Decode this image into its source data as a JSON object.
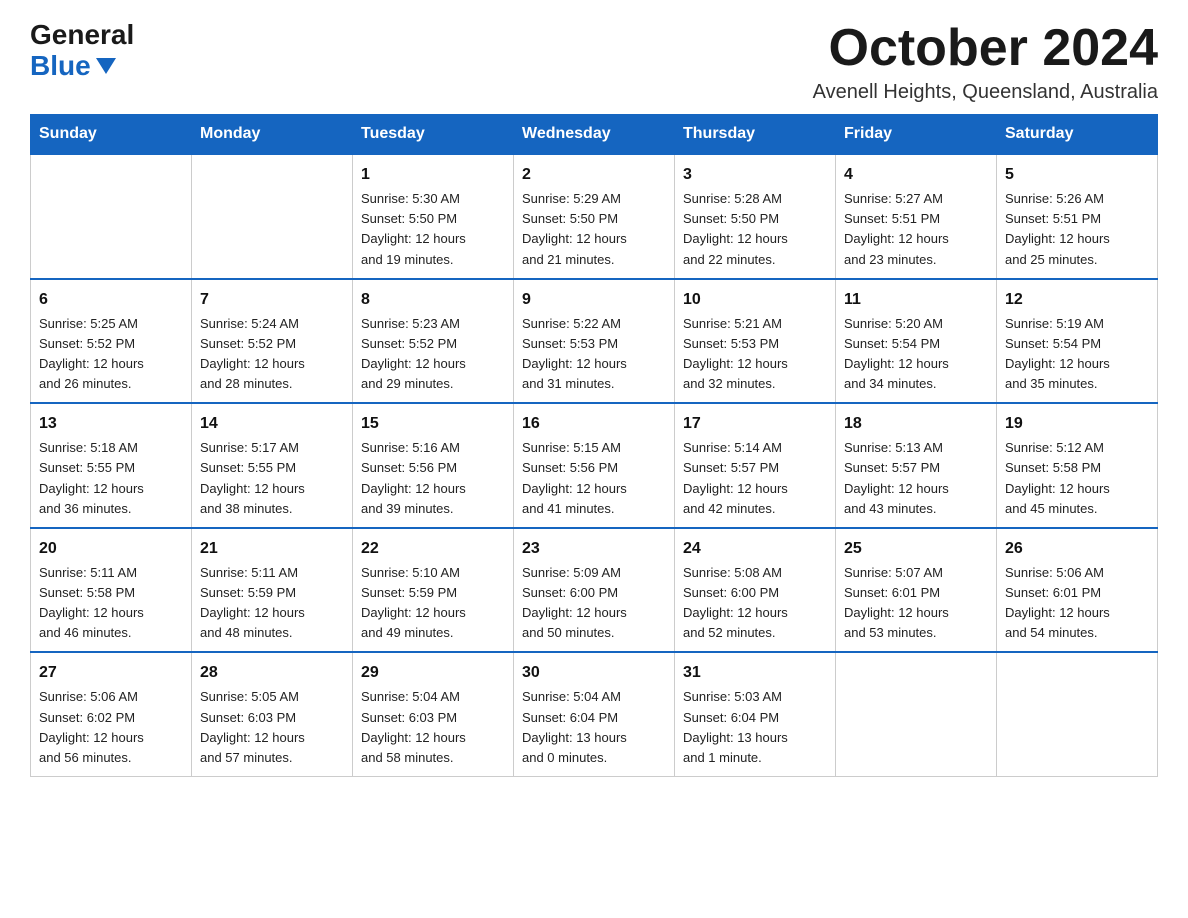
{
  "header": {
    "logo_general": "General",
    "logo_blue": "Blue",
    "month_title": "October 2024",
    "location": "Avenell Heights, Queensland, Australia"
  },
  "weekdays": [
    "Sunday",
    "Monday",
    "Tuesday",
    "Wednesday",
    "Thursday",
    "Friday",
    "Saturday"
  ],
  "weeks": [
    [
      {
        "day": "",
        "info": ""
      },
      {
        "day": "",
        "info": ""
      },
      {
        "day": "1",
        "info": "Sunrise: 5:30 AM\nSunset: 5:50 PM\nDaylight: 12 hours\nand 19 minutes."
      },
      {
        "day": "2",
        "info": "Sunrise: 5:29 AM\nSunset: 5:50 PM\nDaylight: 12 hours\nand 21 minutes."
      },
      {
        "day": "3",
        "info": "Sunrise: 5:28 AM\nSunset: 5:50 PM\nDaylight: 12 hours\nand 22 minutes."
      },
      {
        "day": "4",
        "info": "Sunrise: 5:27 AM\nSunset: 5:51 PM\nDaylight: 12 hours\nand 23 minutes."
      },
      {
        "day": "5",
        "info": "Sunrise: 5:26 AM\nSunset: 5:51 PM\nDaylight: 12 hours\nand 25 minutes."
      }
    ],
    [
      {
        "day": "6",
        "info": "Sunrise: 5:25 AM\nSunset: 5:52 PM\nDaylight: 12 hours\nand 26 minutes."
      },
      {
        "day": "7",
        "info": "Sunrise: 5:24 AM\nSunset: 5:52 PM\nDaylight: 12 hours\nand 28 minutes."
      },
      {
        "day": "8",
        "info": "Sunrise: 5:23 AM\nSunset: 5:52 PM\nDaylight: 12 hours\nand 29 minutes."
      },
      {
        "day": "9",
        "info": "Sunrise: 5:22 AM\nSunset: 5:53 PM\nDaylight: 12 hours\nand 31 minutes."
      },
      {
        "day": "10",
        "info": "Sunrise: 5:21 AM\nSunset: 5:53 PM\nDaylight: 12 hours\nand 32 minutes."
      },
      {
        "day": "11",
        "info": "Sunrise: 5:20 AM\nSunset: 5:54 PM\nDaylight: 12 hours\nand 34 minutes."
      },
      {
        "day": "12",
        "info": "Sunrise: 5:19 AM\nSunset: 5:54 PM\nDaylight: 12 hours\nand 35 minutes."
      }
    ],
    [
      {
        "day": "13",
        "info": "Sunrise: 5:18 AM\nSunset: 5:55 PM\nDaylight: 12 hours\nand 36 minutes."
      },
      {
        "day": "14",
        "info": "Sunrise: 5:17 AM\nSunset: 5:55 PM\nDaylight: 12 hours\nand 38 minutes."
      },
      {
        "day": "15",
        "info": "Sunrise: 5:16 AM\nSunset: 5:56 PM\nDaylight: 12 hours\nand 39 minutes."
      },
      {
        "day": "16",
        "info": "Sunrise: 5:15 AM\nSunset: 5:56 PM\nDaylight: 12 hours\nand 41 minutes."
      },
      {
        "day": "17",
        "info": "Sunrise: 5:14 AM\nSunset: 5:57 PM\nDaylight: 12 hours\nand 42 minutes."
      },
      {
        "day": "18",
        "info": "Sunrise: 5:13 AM\nSunset: 5:57 PM\nDaylight: 12 hours\nand 43 minutes."
      },
      {
        "day": "19",
        "info": "Sunrise: 5:12 AM\nSunset: 5:58 PM\nDaylight: 12 hours\nand 45 minutes."
      }
    ],
    [
      {
        "day": "20",
        "info": "Sunrise: 5:11 AM\nSunset: 5:58 PM\nDaylight: 12 hours\nand 46 minutes."
      },
      {
        "day": "21",
        "info": "Sunrise: 5:11 AM\nSunset: 5:59 PM\nDaylight: 12 hours\nand 48 minutes."
      },
      {
        "day": "22",
        "info": "Sunrise: 5:10 AM\nSunset: 5:59 PM\nDaylight: 12 hours\nand 49 minutes."
      },
      {
        "day": "23",
        "info": "Sunrise: 5:09 AM\nSunset: 6:00 PM\nDaylight: 12 hours\nand 50 minutes."
      },
      {
        "day": "24",
        "info": "Sunrise: 5:08 AM\nSunset: 6:00 PM\nDaylight: 12 hours\nand 52 minutes."
      },
      {
        "day": "25",
        "info": "Sunrise: 5:07 AM\nSunset: 6:01 PM\nDaylight: 12 hours\nand 53 minutes."
      },
      {
        "day": "26",
        "info": "Sunrise: 5:06 AM\nSunset: 6:01 PM\nDaylight: 12 hours\nand 54 minutes."
      }
    ],
    [
      {
        "day": "27",
        "info": "Sunrise: 5:06 AM\nSunset: 6:02 PM\nDaylight: 12 hours\nand 56 minutes."
      },
      {
        "day": "28",
        "info": "Sunrise: 5:05 AM\nSunset: 6:03 PM\nDaylight: 12 hours\nand 57 minutes."
      },
      {
        "day": "29",
        "info": "Sunrise: 5:04 AM\nSunset: 6:03 PM\nDaylight: 12 hours\nand 58 minutes."
      },
      {
        "day": "30",
        "info": "Sunrise: 5:04 AM\nSunset: 6:04 PM\nDaylight: 13 hours\nand 0 minutes."
      },
      {
        "day": "31",
        "info": "Sunrise: 5:03 AM\nSunset: 6:04 PM\nDaylight: 13 hours\nand 1 minute."
      },
      {
        "day": "",
        "info": ""
      },
      {
        "day": "",
        "info": ""
      }
    ]
  ]
}
